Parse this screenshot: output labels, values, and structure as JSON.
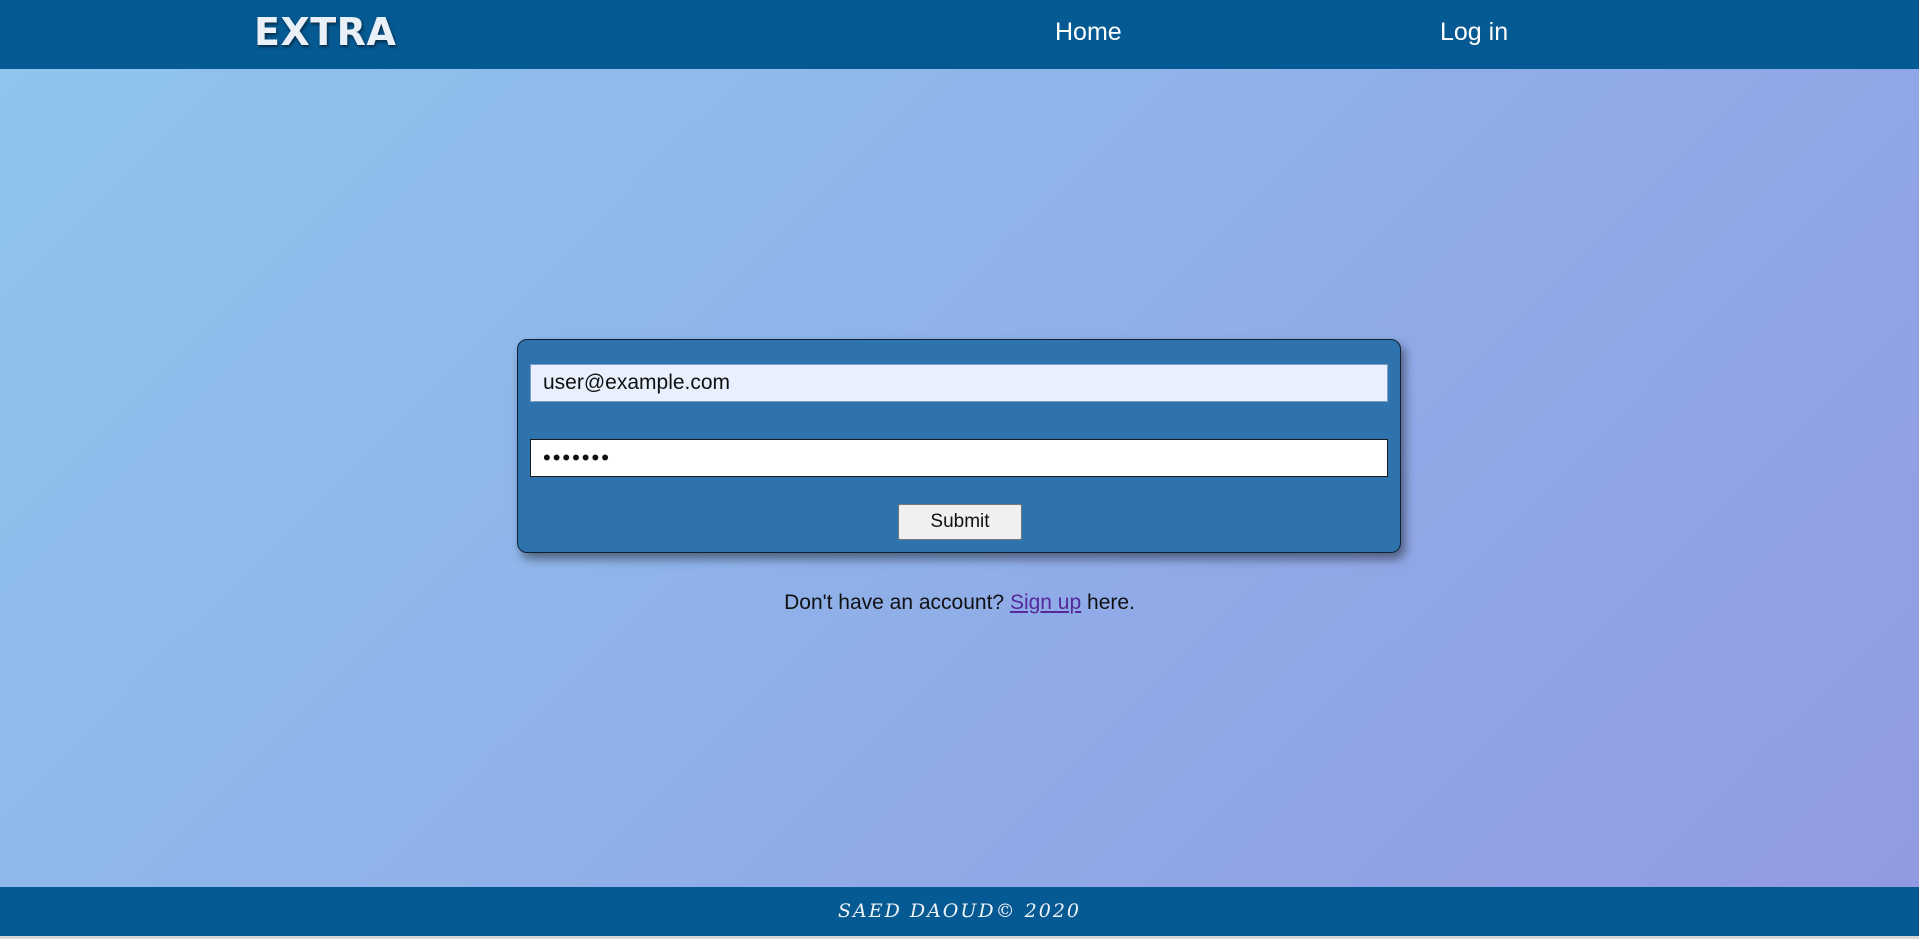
{
  "navbar": {
    "brand": "EXTRA",
    "links": [
      {
        "label": "Home"
      },
      {
        "label": "Log in"
      }
    ]
  },
  "login_form": {
    "email_value": "user@example.com",
    "password_value": "•••••••",
    "submit_label": "Submit"
  },
  "signup": {
    "prefix": "Don't have an account?",
    "link_label": "Sign up",
    "suffix": "here."
  },
  "footer": {
    "text": "SAED DAOUD© 2020"
  },
  "colors": {
    "navbar_bg": "#065a93",
    "card_bg": "#2e73ad",
    "link_visited": "#55289b"
  }
}
